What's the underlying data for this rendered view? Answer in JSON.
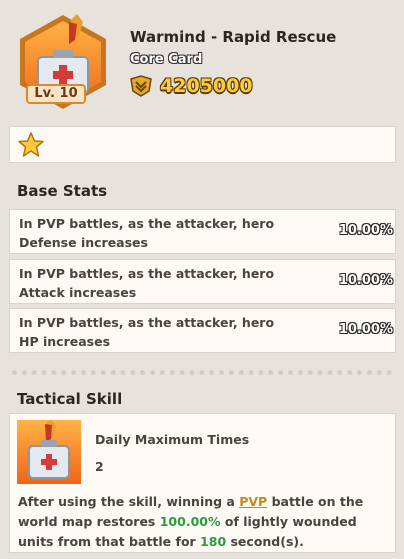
{
  "card": {
    "title": "Warmind - Rapid Rescue",
    "type": "Core Card",
    "level": "Lv. 10",
    "power": "4205000",
    "icons": {
      "card": "medkit-icon",
      "power": "power-icon",
      "star": "star-icon"
    }
  },
  "base_stats": {
    "title": "Base Stats",
    "items": [
      {
        "line1": "In PVP battles, as the attacker, hero",
        "line2": "Defense increases",
        "value": "10.00%"
      },
      {
        "line1": "In PVP battles, as the attacker, hero",
        "line2": "Attack increases",
        "value": "10.00%"
      },
      {
        "line1": "In PVP battles, as the attacker, hero",
        "line2": "HP increases",
        "value": "10.00%"
      }
    ]
  },
  "tactical_skill": {
    "title": "Tactical Skill",
    "label": "Daily Maximum Times",
    "count": "2",
    "desc_1": "After using the skill, winning a ",
    "desc_link": "PVP",
    "desc_2": " battle on the world map restores ",
    "desc_pct": "100.00%",
    "desc_3": " of lightly wounded units from that battle for ",
    "desc_secs": "180",
    "desc_4": " second(s)."
  },
  "colors": {
    "background": "#e7e2dc",
    "panel": "#fdfaf6",
    "power": "#ffcb2e",
    "highlight_green": "#2f9b3c",
    "link": "#c58a1a"
  }
}
